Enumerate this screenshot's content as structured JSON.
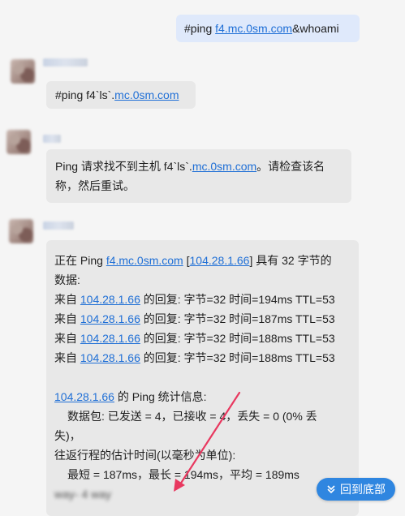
{
  "messages": {
    "sent": {
      "prefix": "#ping ",
      "link": "f4.mc.0sm.com",
      "suffix": "&whoami"
    },
    "msg1": {
      "prefix": "#ping f4`ls`.",
      "link": "mc.0sm.com"
    },
    "msg2": {
      "line1_prefix": "Ping 请求找不到主机 f4`ls`.",
      "line1_link": "mc.0sm.com",
      "line1_suffix": "。请检查该名",
      "line2": "称，然后重试。"
    },
    "msg3": {
      "l1_prefix": "正在 Ping ",
      "l1_host": "f4.mc.0sm.com",
      "l1_mid": " [",
      "l1_ip": "104.28.1.66",
      "l1_suffix": "] 具有 32 字节的",
      "l2": "数据:",
      "replies": [
        {
          "prefix": "来自 ",
          "ip": "104.28.1.66",
          "text": " 的回复: 字节=32 时间=194ms TTL=53"
        },
        {
          "prefix": "来自 ",
          "ip": "104.28.1.66",
          "text": " 的回复: 字节=32 时间=187ms TTL=53"
        },
        {
          "prefix": "来自 ",
          "ip": "104.28.1.66",
          "text": " 的回复: 字节=32 时间=188ms TTL=53"
        },
        {
          "prefix": "来自 ",
          "ip": "104.28.1.66",
          "text": " 的回复: 字节=32 时间=188ms TTL=53"
        }
      ],
      "stats_ip": "104.28.1.66",
      "stats_title": " 的 Ping 统计信息:",
      "packets_line1": "数据包: 已发送 = 4，已接收 = 4，丢失 = 0 (0% 丢",
      "packets_line2": "失)，",
      "rtt_title": "往返行程的估计时间(以毫秒为单位):",
      "rtt_values": "最短 = 187ms，最长 = 194ms，平均 = 189ms",
      "last_line": "way-    4     way"
    }
  },
  "scroll_button": {
    "label": "回到底部"
  },
  "colors": {
    "accent": "#2f86e0",
    "link": "#1f6fd6",
    "arrow": "#e8385f"
  }
}
